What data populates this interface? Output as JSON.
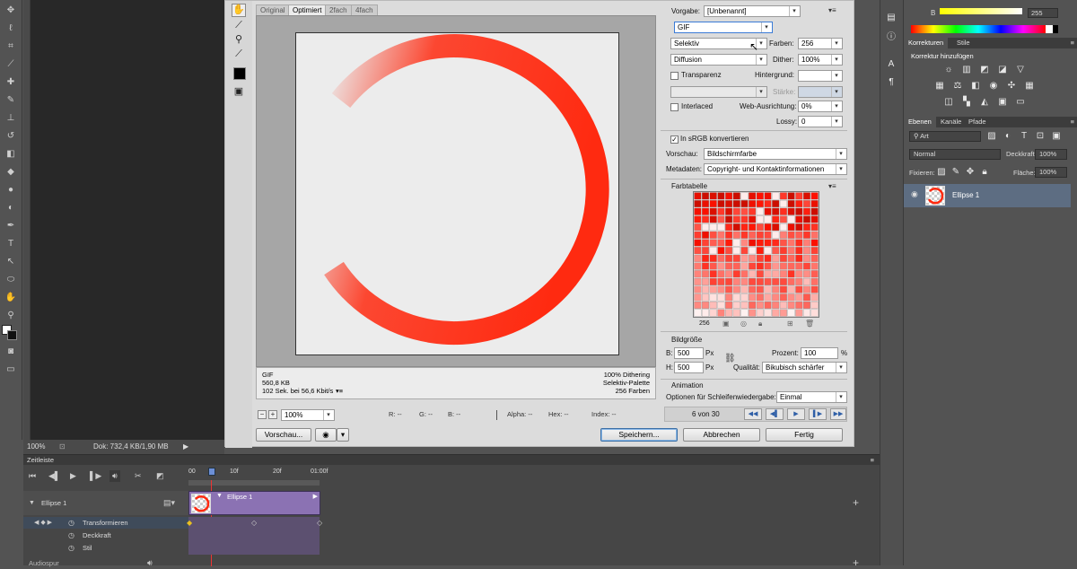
{
  "statusbar": {
    "zoom": "100%",
    "doc": "Dok: 732,4 KB/1,90 MB"
  },
  "dialog": {
    "tabs": [
      "Original",
      "Optimiert",
      "2fach",
      "4fach"
    ],
    "info_left": [
      "GIF",
      "560,8 KB",
      "102 Sek. bei 56,6 Kbit/s"
    ],
    "info_right": [
      "100% Dithering",
      "Selektiv-Palette",
      "256 Farben"
    ],
    "zoom": "100%",
    "readouts": {
      "r": "R: --",
      "g": "G: --",
      "b": "B: --",
      "alpha": "Alpha: --",
      "hex": "Hex: --",
      "index": "Index: --"
    },
    "preview_button": "Vorschau...",
    "buttons": {
      "save": "Speichern...",
      "cancel": "Abbrechen",
      "done": "Fertig"
    },
    "settings": {
      "preset_label": "Vorgabe:",
      "preset": "[Unbenannt]",
      "format": "GIF",
      "reduction": "Selektiv",
      "colors_label": "Farben:",
      "colors": "256",
      "dither_algo": "Diffusion",
      "dither_label": "Dither:",
      "dither": "100%",
      "transparency": "Transparenz",
      "matte_label": "Hintergrund:",
      "amount_label": "Stärke:",
      "interlaced": "Interlaced",
      "websnap_label": "Web-Ausrichtung:",
      "websnap": "0%",
      "lossy_label": "Lossy:",
      "lossy": "0",
      "srgb": "In sRGB konvertieren",
      "preview_label": "Vorschau:",
      "preview": "Bildschirmfarbe",
      "metadata_label": "Metadaten:",
      "metadata": "Copyright- und Kontaktinformationen"
    },
    "colortable": {
      "title": "Farbtabelle",
      "count": "256"
    },
    "imagesize": {
      "title": "Bildgröße",
      "w_label": "B:",
      "w": "500",
      "h_label": "H:",
      "h": "500",
      "unit": "Px",
      "percent_label": "Prozent:",
      "percent": "100",
      "percent_unit": "%",
      "quality_label": "Qualität:",
      "quality": "Bikubisch schärfer"
    },
    "animation": {
      "title": "Animation",
      "loop_label": "Optionen für Schleifenwiedergabe:",
      "loop": "Einmal",
      "frame": "6 von 30"
    }
  },
  "right": {
    "color_b": "B",
    "color_val": "255",
    "adjust_tabs": [
      "Korrekturen",
      "Stile"
    ],
    "adjust_title": "Korrektur hinzufügen",
    "layer_tabs": [
      "Ebenen",
      "Kanäle",
      "Pfade"
    ],
    "filter_kind": "Art",
    "blend": "Normal",
    "opacity_label": "Deckkraft:",
    "opacity": "100%",
    "lock_label": "Fixieren:",
    "fill_label": "Fläche:",
    "fill": "100%",
    "layer_name": "Ellipse 1"
  },
  "timeline": {
    "title": "Zeitleiste",
    "ruler": [
      "00",
      "10f",
      "20f",
      "01:00f"
    ],
    "layer": "Ellipse 1",
    "clip": "Ellipse 1",
    "props": [
      "Transformieren",
      "Deckkraft",
      "Stil"
    ],
    "audio": "Audiospur"
  },
  "colors": {
    "accent_red": "#ff2a10",
    "clip": "#8b72b3",
    "layer_sel": "#5d6d82"
  }
}
